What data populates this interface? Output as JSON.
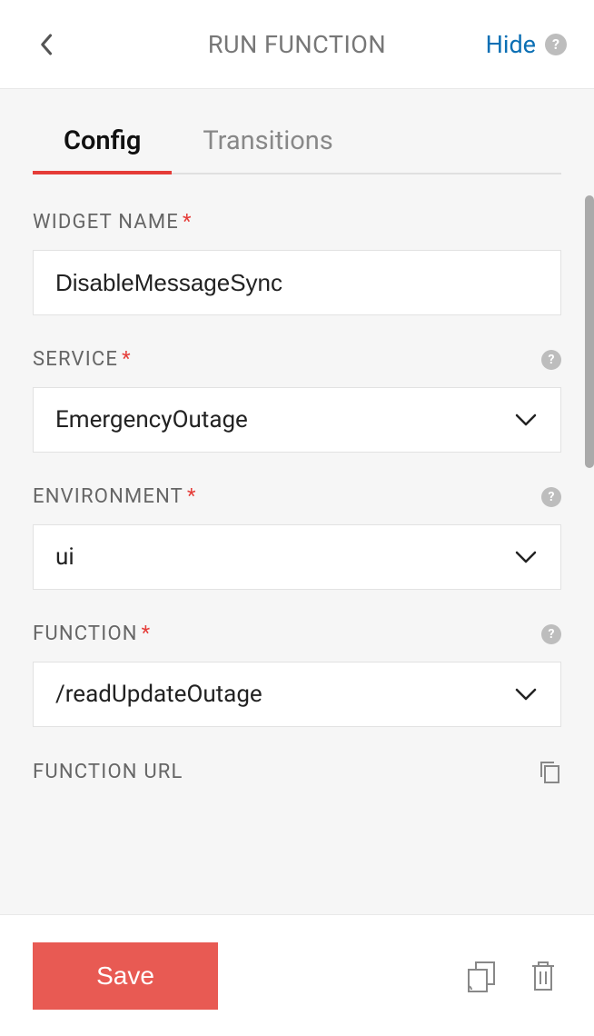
{
  "header": {
    "title": "RUN FUNCTION",
    "hide_label": "Hide"
  },
  "tabs": [
    {
      "label": "Config",
      "active": true
    },
    {
      "label": "Transitions",
      "active": false
    }
  ],
  "form": {
    "widget_name": {
      "label": "WIDGET NAME",
      "required": true,
      "value": "DisableMessageSync"
    },
    "service": {
      "label": "SERVICE",
      "required": true,
      "value": "EmergencyOutage"
    },
    "environment": {
      "label": "ENVIRONMENT",
      "required": true,
      "value": "ui"
    },
    "function": {
      "label": "FUNCTION",
      "required": true,
      "value": "/readUpdateOutage"
    },
    "function_url": {
      "label": "FUNCTION URL"
    }
  },
  "footer": {
    "save_label": "Save"
  },
  "colors": {
    "accent": "#e53c38",
    "link": "#0b6fb4"
  }
}
